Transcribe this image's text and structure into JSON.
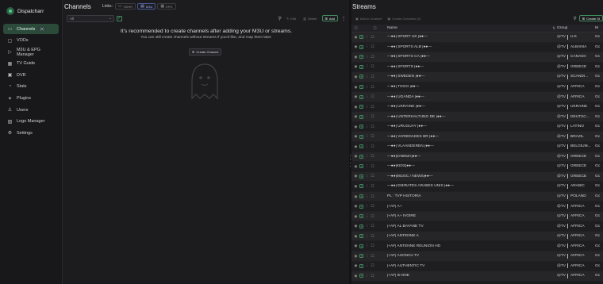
{
  "app": {
    "name": "Dispatcharr"
  },
  "sidebar": {
    "items": [
      {
        "label": "Channels",
        "badge": "(0)",
        "icon": "tv-icon",
        "glyph": "▭",
        "active": true
      },
      {
        "label": "VODs",
        "icon": "video-icon",
        "glyph": "▢",
        "active": false
      },
      {
        "label": "M3U & EPG Manager",
        "icon": "play-list-icon",
        "glyph": "▷",
        "active": false
      },
      {
        "label": "TV Guide",
        "icon": "layout-grid-icon",
        "glyph": "▦",
        "active": false
      },
      {
        "label": "DVR",
        "icon": "record-icon",
        "glyph": "▣",
        "active": false
      },
      {
        "label": "Stats",
        "icon": "chart-icon",
        "glyph": "◔",
        "active": false
      },
      {
        "label": "Plugins",
        "icon": "plug-icon",
        "glyph": "✦",
        "active": false
      },
      {
        "label": "Users",
        "icon": "users-icon",
        "glyph": "♙",
        "active": false
      },
      {
        "label": "Logo Manager",
        "icon": "image-icon",
        "glyph": "▨",
        "active": false
      },
      {
        "label": "Settings",
        "icon": "gear-icon",
        "glyph": "⚙",
        "active": false
      }
    ]
  },
  "channels": {
    "title": "Channels",
    "links_label": "Links:",
    "links": [
      {
        "label": "HDHR",
        "icon": "tv-icon",
        "glyph": "▭",
        "on": false
      },
      {
        "label": "M3U",
        "icon": "list-icon",
        "glyph": "▤",
        "on": true
      },
      {
        "label": "EPG",
        "icon": "calendar-icon",
        "glyph": "▦",
        "on": false
      }
    ],
    "filter_value": "All",
    "toolbar": {
      "edit": "Edit",
      "delete": "Delete",
      "add": "Add"
    },
    "empty_title": "It's recommended to create channels after adding your M3U or streams.",
    "empty_text": "You can still create channels without streams if you'd like, and map them later.",
    "create_button": "Create Channel"
  },
  "streams": {
    "title": "Streams",
    "toolbar": {
      "add_to_channel": "Add to Channel",
      "create_channels": "Create Channels (0)",
      "create": "Create St"
    },
    "columns": {
      "name": "Name",
      "group": "Group",
      "extra": "M"
    },
    "rows": [
      {
        "name": "—●●| SPORT UK |●●—",
        "prefix": "@TV",
        "group": "U.K",
        "extra": "Gc"
      },
      {
        "name": "—●●| SPORTS ALB |●●—",
        "prefix": "@TV",
        "group": "ALBANIA",
        "extra": "Gc"
      },
      {
        "name": "—●●| SPORTS CA |●●—",
        "prefix": "@TV",
        "group": "CANADA",
        "extra": "Gc"
      },
      {
        "name": "—●●| SPORTS |●●—",
        "prefix": "@TV",
        "group": "GREECE",
        "extra": "Gc"
      },
      {
        "name": "—●●| SWEDEN |●●—",
        "prefix": "@TV",
        "group": "SCANDI...",
        "extra": "Gc"
      },
      {
        "name": "—●●| TOGO |●●—",
        "prefix": "@TV",
        "group": "AFRICA",
        "extra": "Gc"
      },
      {
        "name": "—●●| UGANDA |●●—",
        "prefix": "@TV",
        "group": "AFRICA",
        "extra": "Gc"
      },
      {
        "name": "—●●| UKRAINE |●●—",
        "prefix": "@TV",
        "group": "UKRAINE",
        "extra": "Gc"
      },
      {
        "name": "—●●| UNTERHALTUNG DE |●●—",
        "prefix": "@TV",
        "group": "DEUTSC...",
        "extra": "Gc"
      },
      {
        "name": "—●●| URUGUAY |●●—",
        "prefix": "@TV",
        "group": "LATINO",
        "extra": "Gc"
      },
      {
        "name": "—●●| VARIEDADES BR |●●—",
        "prefix": "@TV",
        "group": "BRAZIL",
        "extra": "Gc"
      },
      {
        "name": "—●●| VLAANDEREN |●●—",
        "prefix": "@TV",
        "group": "BELGIUM...",
        "extra": "Gc"
      },
      {
        "name": "—●●|CINEMA|●●—",
        "prefix": "@TV",
        "group": "GREECE",
        "extra": "Gc"
      },
      {
        "name": "—●●|KIDS|●●—",
        "prefix": "@TV",
        "group": "GREECE",
        "extra": "Gc"
      },
      {
        "name": "—●●|MUSIC / NEWS|●●—",
        "prefix": "@TV",
        "group": "GREECE",
        "extra": "Gc"
      },
      {
        "name": "—●●| EMIRATES ARABES UNIS |●●—",
        "prefix": "@TV",
        "group": "ARABIC",
        "extra": "Gc"
      },
      {
        "name": "PL : TVP HISTORIA",
        "prefix": "@TV",
        "group": "POLAND",
        "extra": "Gc"
      },
      {
        "name": "|+AF| A+",
        "prefix": "@TV",
        "group": "AFRICA",
        "extra": "Gc"
      },
      {
        "name": "|+AF| A+ IVOIRE",
        "prefix": "@TV",
        "group": "AFRICA",
        "extra": "Gc"
      },
      {
        "name": "|+AF| AL BAYANE TV",
        "prefix": "@TV",
        "group": "AFRICA",
        "extra": "Gc"
      },
      {
        "name": "|+AF| ANTENNE A",
        "prefix": "@TV",
        "group": "AFRICA",
        "extra": "Gc"
      },
      {
        "name": "|+AF| ANTENNE REUNION HD",
        "prefix": "@TV",
        "group": "AFRICA",
        "extra": "Gc"
      },
      {
        "name": "|+AF| ASONGA TV",
        "prefix": "@TV",
        "group": "AFRICA",
        "extra": "Gc"
      },
      {
        "name": "|+AF| AUTHENTIC TV",
        "prefix": "@TV",
        "group": "AFRICA",
        "extra": "Gc"
      },
      {
        "name": "|+AF| B-ONE",
        "prefix": "@TV",
        "group": "AFRICA",
        "extra": "Gc"
      }
    ]
  }
}
